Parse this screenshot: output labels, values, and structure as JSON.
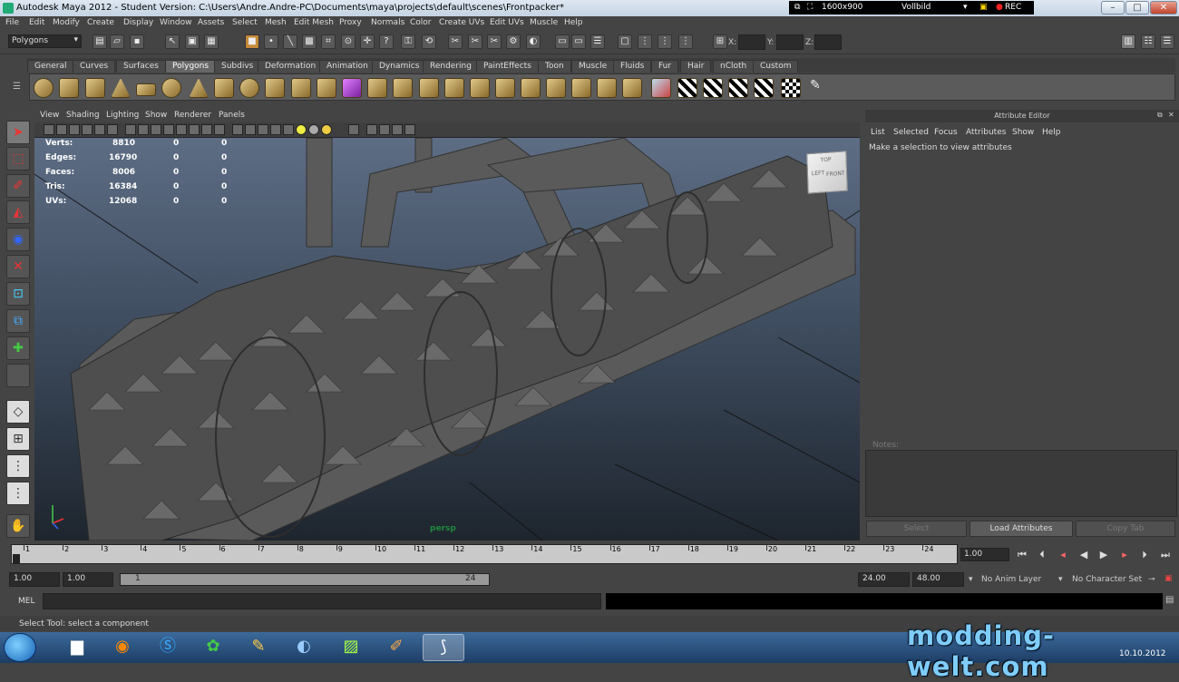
{
  "window": {
    "title": "Autodesk Maya 2012 - Student Version: C:\\Users\\Andre.Andre-PC\\Documents\\maya\\projects\\default\\scenes\\Frontpacker*",
    "rec_resolution": "1600x900",
    "rec_mode": "Vollbild",
    "rec_label": "REC",
    "minimize": "–",
    "maximize": "□",
    "close": "✕"
  },
  "menubar": [
    "File",
    "Edit",
    "Modify",
    "Create",
    "Display",
    "Window",
    "Assets",
    "Select",
    "Mesh",
    "Edit Mesh",
    "Proxy",
    "Normals",
    "Color",
    "Create UVs",
    "Edit UVs",
    "Muscle",
    "Help"
  ],
  "status": {
    "mode": "Polygons",
    "x_label": "X:",
    "y_label": "Y:",
    "z_label": "Z:"
  },
  "shelf_tabs": [
    "General",
    "Curves",
    "Surfaces",
    "Polygons",
    "Subdivs",
    "Deformation",
    "Animation",
    "Dynamics",
    "Rendering",
    "PaintEffects",
    "Toon",
    "Muscle",
    "Fluids",
    "Fur",
    "Hair",
    "nCloth",
    "Custom"
  ],
  "shelf_active": "Polygons",
  "panel_menu": [
    "View",
    "Shading",
    "Lighting",
    "Show",
    "Renderer",
    "Panels"
  ],
  "hud": [
    {
      "label": "Verts:",
      "v1": "8810",
      "v2": "0",
      "v3": "0"
    },
    {
      "label": "Edges:",
      "v1": "16790",
      "v2": "0",
      "v3": "0"
    },
    {
      "label": "Faces:",
      "v1": "8006",
      "v2": "0",
      "v3": "0"
    },
    {
      "label": "Tris:",
      "v1": "16384",
      "v2": "0",
      "v3": "0"
    },
    {
      "label": "UVs:",
      "v1": "12068",
      "v2": "0",
      "v3": "0"
    }
  ],
  "viewport": {
    "camera": "persp",
    "cube_top": "TOP",
    "cube_front": "FRONT",
    "cube_left": "LEFT"
  },
  "attribute_editor": {
    "title": "Attribute Editor",
    "menu": [
      "List",
      "Selected",
      "Focus",
      "Attributes",
      "Show",
      "Help"
    ],
    "message": "Make a selection to view attributes",
    "notes_label": "Notes:",
    "btn_select": "Select",
    "btn_load": "Load Attributes",
    "btn_copy": "Copy Tab"
  },
  "timeline": {
    "ticks": [
      "1",
      "2",
      "3",
      "4",
      "5",
      "6",
      "7",
      "8",
      "9",
      "10",
      "11",
      "12",
      "13",
      "14",
      "15",
      "16",
      "17",
      "18",
      "19",
      "20",
      "21",
      "22",
      "23",
      "24"
    ],
    "current_frame": "1.00"
  },
  "range": {
    "start": "1.00",
    "anim_start": "1.00",
    "range_start": "1",
    "range_end": "24",
    "end": "24.00",
    "anim_end": "48.00",
    "anim_layer": "No Anim Layer",
    "char_set": "No Character Set"
  },
  "command": {
    "mel": "MEL"
  },
  "help": "Select Tool: select a component",
  "watermark": "modding-welt.com",
  "clock": "10.10.2012",
  "colors": {
    "accent": "#1d8a3e",
    "watermark": "#7fcdfb"
  }
}
